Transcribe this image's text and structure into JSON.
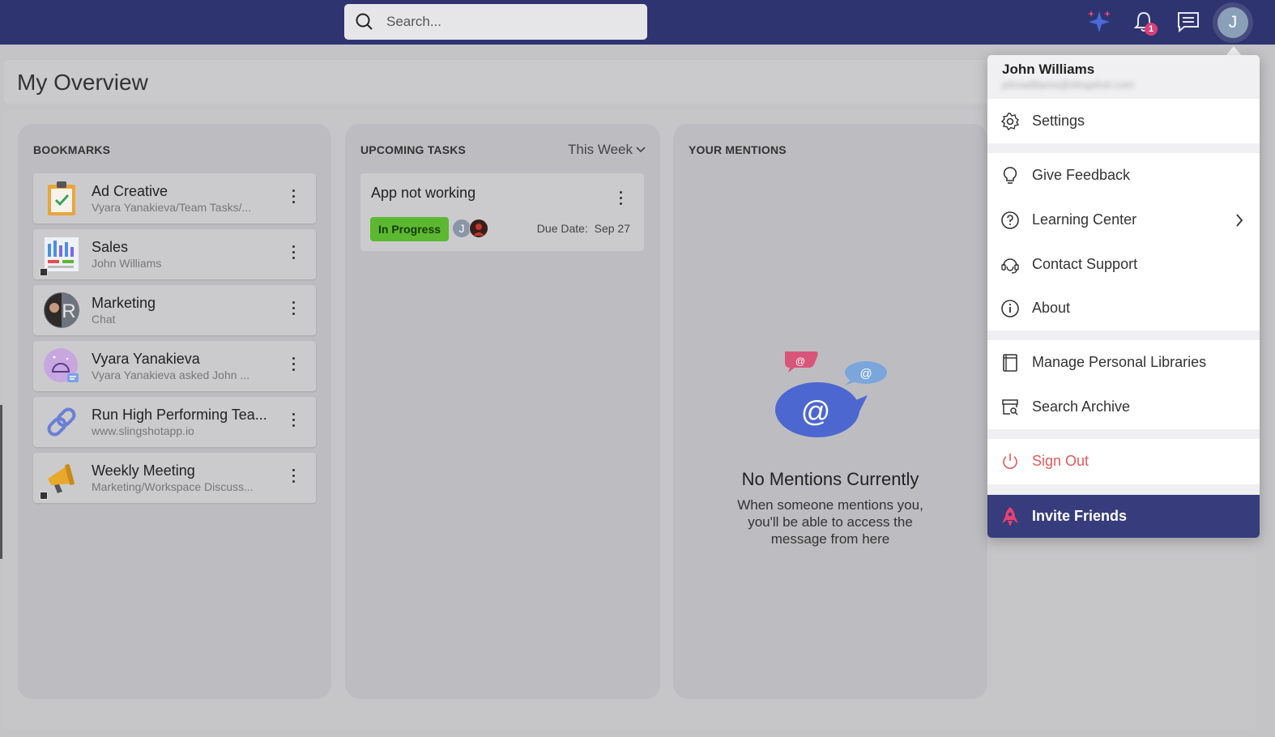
{
  "search": {
    "placeholder": "Search..."
  },
  "notifications": {
    "count": "1"
  },
  "user": {
    "initial": "J",
    "name": "John Williams",
    "email": "johnwilliams@slingshot.com"
  },
  "page": {
    "title": "My Overview"
  },
  "bookmarks": {
    "title": "BOOKMARKS",
    "items": [
      {
        "title": "Ad Creative",
        "subtitle": "Vyara Yanakieva/Team Tasks/..."
      },
      {
        "title": "Sales",
        "subtitle": "John Williams"
      },
      {
        "title": "Marketing",
        "subtitle": "Chat"
      },
      {
        "title": "Vyara Yanakieva",
        "subtitle": "Vyara Yanakieva asked John ..."
      },
      {
        "title": "Run High Performing Tea...",
        "subtitle": "www.slingshotapp.io"
      },
      {
        "title": "Weekly Meeting",
        "subtitle": "Marketing/Workspace Discuss..."
      }
    ]
  },
  "tasks": {
    "title": "UPCOMING TASKS",
    "filter": "This Week",
    "items": [
      {
        "title": "App not working",
        "status": "In Progress",
        "assignee_initial": "J",
        "due_label": "Due Date:",
        "due_date": "Sep 27"
      }
    ]
  },
  "mentions": {
    "title": "YOUR MENTIONS",
    "empty_title": "No Mentions Currently",
    "empty_text": "When someone mentions you, you'll be able to access the message from here"
  },
  "menu": {
    "settings": "Settings",
    "feedback": "Give Feedback",
    "learning": "Learning Center",
    "support": "Contact Support",
    "about": "About",
    "libraries": "Manage Personal Libraries",
    "archive": "Search Archive",
    "signout": "Sign Out",
    "invite": "Invite Friends"
  },
  "colors": {
    "topbar": "#2e3470",
    "accent": "#373c7c",
    "status_green": "#5cb830",
    "signout_red": "#e05a5a"
  }
}
